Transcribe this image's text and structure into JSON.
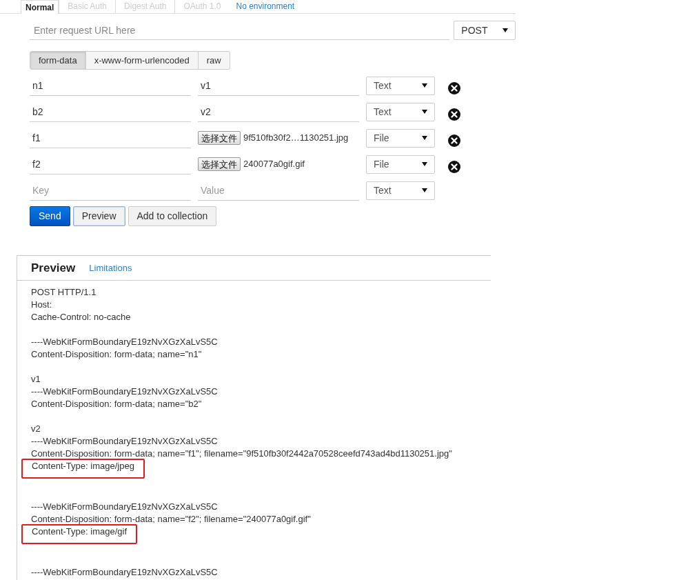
{
  "auth_tabs": [
    {
      "label": "Normal",
      "selected": true
    },
    {
      "label": "Basic Auth",
      "selected": false
    },
    {
      "label": "Digest Auth",
      "selected": false
    },
    {
      "label": "OAuth 1.0",
      "selected": false
    }
  ],
  "environment": "No environment",
  "url": {
    "placeholder": "Enter request URL here"
  },
  "method": "POST",
  "body_tabs": [
    {
      "label": "form-data",
      "selected": true
    },
    {
      "label": "x-www-form-urlencoded",
      "selected": false
    },
    {
      "label": "raw",
      "selected": false
    }
  ],
  "params": [
    {
      "kind": "text",
      "key": "n1",
      "value": "v1",
      "type": "Text",
      "removable": true
    },
    {
      "kind": "text",
      "key": "b2",
      "value": "v2",
      "type": "Text",
      "removable": true
    },
    {
      "kind": "file",
      "key": "f1",
      "button": "选择文件",
      "file": "9f510fb30f2…1130251.jpg",
      "type": "File",
      "removable": true
    },
    {
      "kind": "file",
      "key": "f2",
      "button": "选择文件",
      "file": "240077a0gif.gif",
      "type": "File",
      "removable": true
    },
    {
      "kind": "text",
      "key_placeholder": "Key",
      "value_placeholder": "Value",
      "type": "Text",
      "removable": false
    }
  ],
  "buttons": [
    {
      "label": "Send",
      "kind": "primary"
    },
    {
      "label": "Preview",
      "kind": "active"
    },
    {
      "label": "Add to collection",
      "kind": "default"
    }
  ],
  "preview": {
    "title": "Preview",
    "link": "Limitations",
    "blocks": [
      [
        {
          "text": "POST HTTP/1.1",
          "highlighted": false
        },
        {
          "text": "Host:",
          "highlighted": false
        },
        {
          "text": "Cache-Control: no-cache",
          "highlighted": false
        }
      ],
      [
        {
          "text": "----WebKitFormBoundaryE19zNvXGzXaLvS5C",
          "highlighted": false
        },
        {
          "text": "Content-Disposition: form-data; name=\"n1\"",
          "highlighted": false
        }
      ],
      [
        {
          "text": "v1",
          "highlighted": false
        },
        {
          "text": "----WebKitFormBoundaryE19zNvXGzXaLvS5C",
          "highlighted": false
        },
        {
          "text": "Content-Disposition: form-data; name=\"b2\"",
          "highlighted": false
        }
      ],
      [
        {
          "text": "v2",
          "highlighted": false
        },
        {
          "text": "----WebKitFormBoundaryE19zNvXGzXaLvS5C",
          "highlighted": false
        },
        {
          "text": "Content-Disposition: form-data; name=\"f1\"; filename=\"9f510fb30f2442a70528ceefd743ad4bd1130251.jpg\"",
          "highlighted": false
        },
        {
          "text": "Content-Type: image/jpeg",
          "highlighted": true
        }
      ],
      [
        {
          "text": "----WebKitFormBoundaryE19zNvXGzXaLvS5C",
          "highlighted": false
        },
        {
          "text": "Content-Disposition: form-data; name=\"f2\"; filename=\"240077a0gif.gif\"",
          "highlighted": false
        },
        {
          "text": "Content-Type: image/gif",
          "highlighted": true
        }
      ],
      [
        {
          "text": "----WebKitFormBoundaryE19zNvXGzXaLvS5C",
          "highlighted": false
        }
      ]
    ]
  }
}
